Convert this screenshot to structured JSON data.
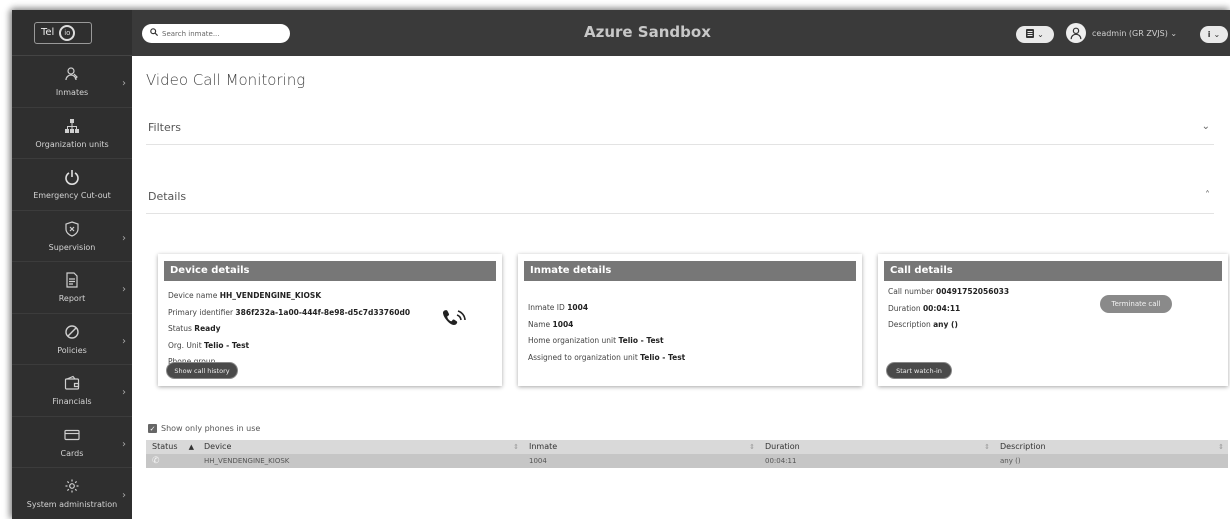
{
  "logo": {
    "text": "Tel",
    "circle": "io"
  },
  "app_title": "Azure Sandbox",
  "search": {
    "placeholder": "Search inmate..."
  },
  "user": {
    "label": "ceadmin (GR ZVJS) ⌄"
  },
  "sidebar": {
    "items": [
      {
        "label": "Inmates",
        "icon": "inmates-icon",
        "has_submenu": true
      },
      {
        "label": "Organization units",
        "icon": "org-tree-icon",
        "has_submenu": false
      },
      {
        "label": "Emergency Cut-out",
        "icon": "power-icon",
        "has_submenu": false
      },
      {
        "label": "Supervision",
        "icon": "shield-icon",
        "has_submenu": true
      },
      {
        "label": "Report",
        "icon": "report-icon",
        "has_submenu": true
      },
      {
        "label": "Policies",
        "icon": "ban-icon",
        "has_submenu": true
      },
      {
        "label": "Financials",
        "icon": "wallet-icon",
        "has_submenu": true
      },
      {
        "label": "Cards",
        "icon": "card-icon",
        "has_submenu": true
      },
      {
        "label": "System administration",
        "icon": "gear-icon",
        "has_submenu": true
      }
    ]
  },
  "page": {
    "title": "Video Call Monitoring",
    "filters_label": "Filters",
    "details_label": "Details"
  },
  "device": {
    "heading": "Device details",
    "name_label": "Device name",
    "name_value": "HH_VENDENGINE_KIOSK",
    "pid_label": "Primary identifier",
    "pid_value": "386f232a-1a00-444f-8e98-d5c7d33760d0",
    "status_label": "Status",
    "status_value": "Ready",
    "org_label": "Org. Unit",
    "org_value": "Telio - Test",
    "phone_group_label": "Phone group",
    "history_button": "Show call history"
  },
  "inmate": {
    "heading": "Inmate details",
    "id_label": "Inmate ID",
    "id_value": "1004",
    "name_label": "Name",
    "name_value": "1004",
    "home_label": "Home organization unit",
    "home_value": "Telio - Test",
    "assigned_label": "Assigned to organization unit",
    "assigned_value": "Telio - Test"
  },
  "call": {
    "heading": "Call details",
    "number_label": "Call number",
    "number_value": "00491752056033",
    "duration_label": "Duration",
    "duration_value": "00:04:11",
    "desc_label": "Description",
    "desc_value": "any ()",
    "terminate_button": "Terminate call",
    "watch_button": "Start watch-in"
  },
  "filter_checkbox": {
    "label": "Show only phones in use",
    "checked": true
  },
  "table": {
    "columns": [
      "Status",
      "Device",
      "Inmate",
      "Duration",
      "Description"
    ],
    "sort_indicator": "▲",
    "rows": [
      {
        "device": "HH_VENDENGINE_KIOSK",
        "inmate": "1004",
        "duration": "00:04:11",
        "description": "any ()"
      }
    ]
  }
}
